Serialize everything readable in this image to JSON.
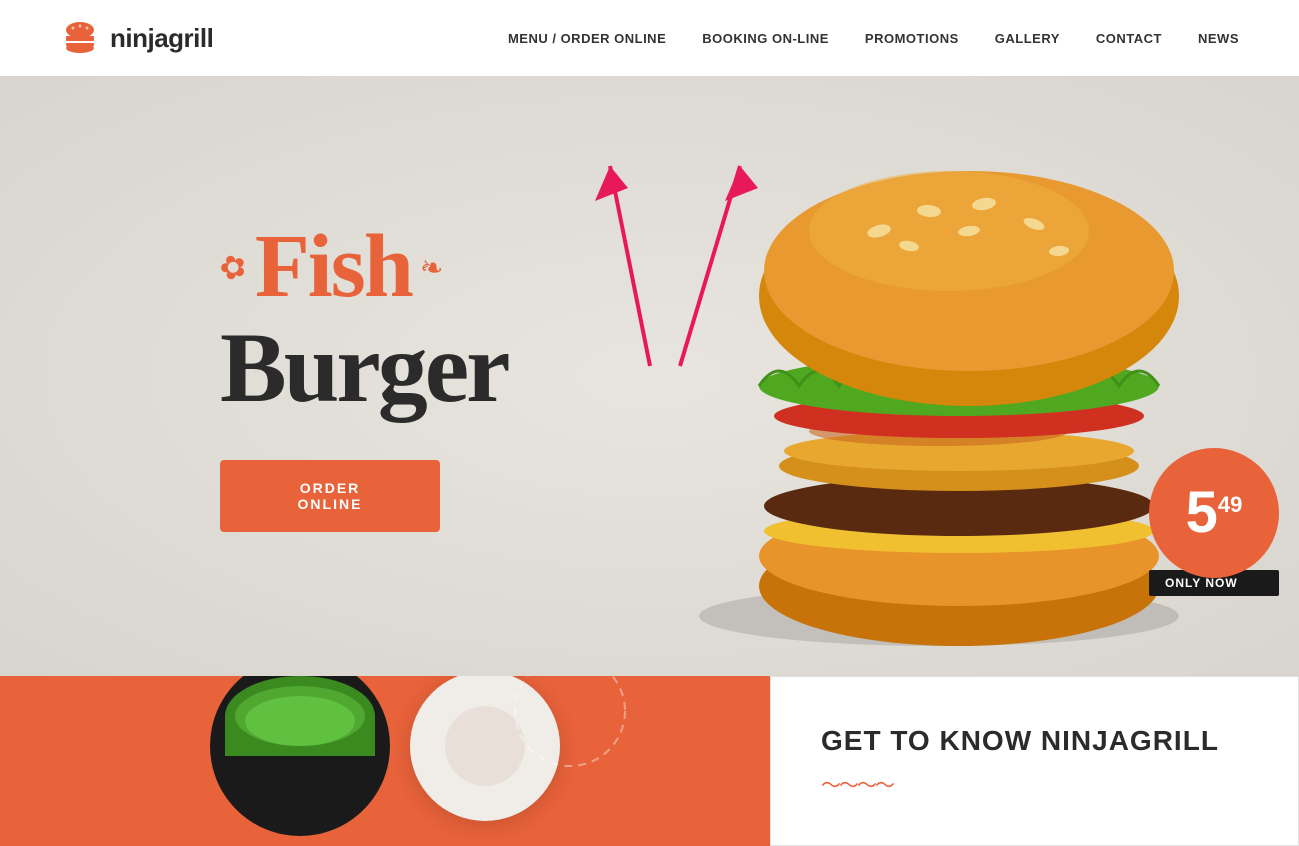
{
  "header": {
    "logo_text": "ninjagrill",
    "nav_items": [
      {
        "label": "MENU / ORDER ONLINE",
        "id": "menu-order"
      },
      {
        "label": "BOOKING ON-LINE",
        "id": "booking"
      },
      {
        "label": "PROMOTIONS",
        "id": "promotions"
      },
      {
        "label": "GALLERY",
        "id": "gallery"
      },
      {
        "label": "CONTACT",
        "id": "contact"
      },
      {
        "label": "NEWS",
        "id": "news"
      }
    ]
  },
  "hero": {
    "title_line1": "Fish",
    "title_line2": "Burger",
    "order_button_label": "ORDER ONLINE",
    "price_main": "5",
    "price_cents": "49",
    "price_tag": "ONLY NOW"
  },
  "bottom": {
    "get_to_know_title": "GET TO KNOW NINJAGRILL"
  }
}
